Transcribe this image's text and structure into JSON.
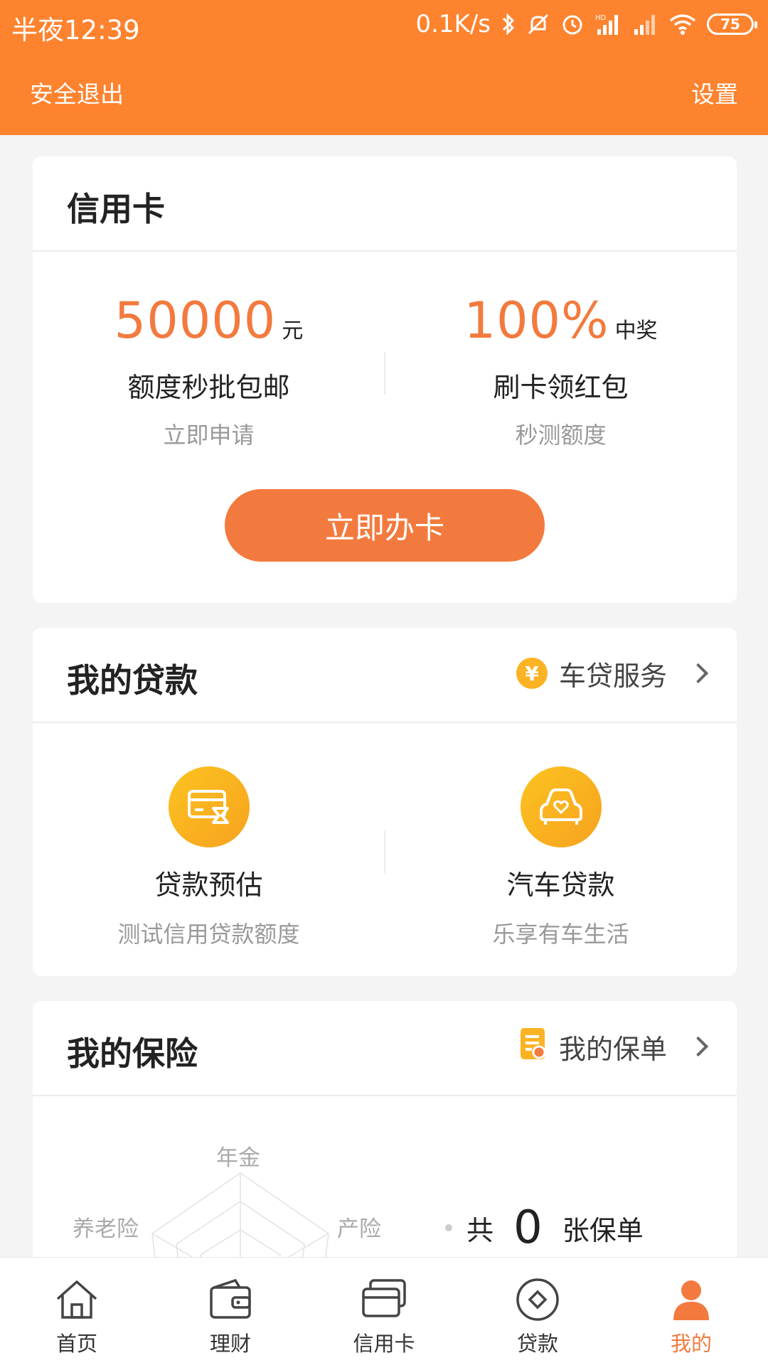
{
  "status_bar": {
    "time": "半夜12:39",
    "net_speed": "0.1K/s",
    "battery": "75",
    "hd_label": "HD"
  },
  "nav": {
    "logout": "安全退出",
    "settings": "设置"
  },
  "credit_card": {
    "title": "信用卡",
    "left": {
      "amount": "50000",
      "unit": "元",
      "name": "额度秒批包邮",
      "sub": "立即申请"
    },
    "right": {
      "amount": "100%",
      "unit": "中奖",
      "name": "刷卡领红包",
      "sub": "秒测额度"
    },
    "button": "立即办卡"
  },
  "loan": {
    "title": "我的贷款",
    "link_label": "车贷服务",
    "link_badge": "¥",
    "items": [
      {
        "name": "贷款预估",
        "sub": "测试信用贷款额度",
        "icon": "card-icon"
      },
      {
        "name": "汽车贷款",
        "sub": "乐享有车生活",
        "icon": "car-icon"
      }
    ]
  },
  "insurance": {
    "title": "我的保险",
    "link_label": "我的保单",
    "radar_labels": [
      "年金",
      "产险",
      "养老险"
    ],
    "total_prefix": "共",
    "total_count": "0",
    "total_suffix": "张保单"
  },
  "tabs": [
    {
      "label": "首页",
      "icon": "home-icon"
    },
    {
      "label": "理财",
      "icon": "wallet-icon"
    },
    {
      "label": "信用卡",
      "icon": "credit-card-icon"
    },
    {
      "label": "贷款",
      "icon": "loan-icon"
    },
    {
      "label": "我的",
      "icon": "user-icon",
      "active": true
    }
  ],
  "colors": {
    "header": "#fe832f",
    "accent": "#f37a3e",
    "gold": "#fbb324"
  }
}
